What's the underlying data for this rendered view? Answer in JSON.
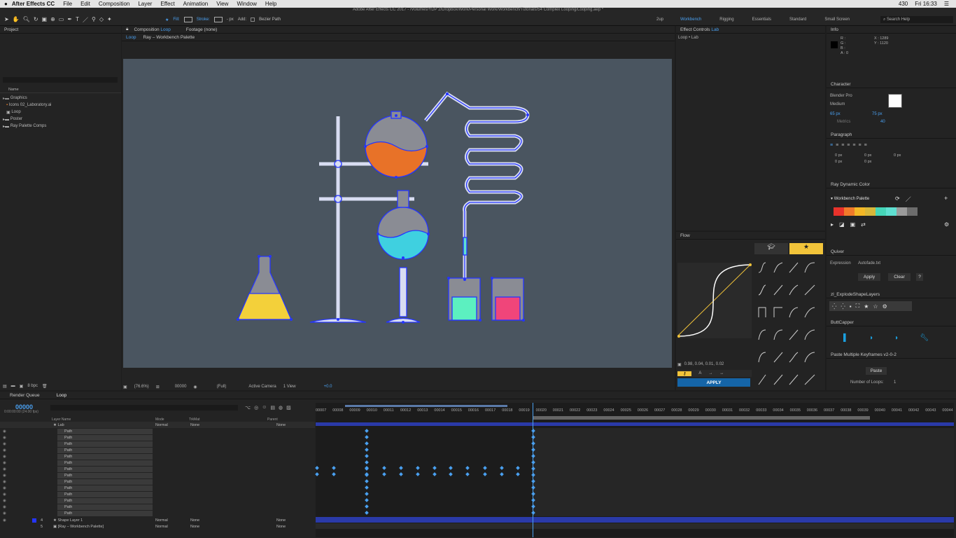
{
  "menubar": {
    "app": "After Effects CC",
    "items": [
      "File",
      "Edit",
      "Composition",
      "Layer",
      "Effect",
      "Animation",
      "View",
      "Window",
      "Help"
    ],
    "status": {
      "battery": "430",
      "clock": "Fri 16:33"
    }
  },
  "window_title": "Adobe After Effects CC 2017 - /Volumes/YDP 2/Dropbox/Work/Personal Work/Workbench/Tutorials/54 Complex Looping/Looping.aep *",
  "toolbar": {
    "fill": "Fill:",
    "stroke": "Stroke:",
    "px": "- px",
    "add": "Add:",
    "bezier": "Bezier Path",
    "twoup": "2up",
    "workspaces": [
      "Workbench",
      "Rigging",
      "Essentials",
      "Standard",
      "Small Screen"
    ],
    "search": "Search Help"
  },
  "project": {
    "title": "Project",
    "col_name": "Name",
    "items": [
      "Graphics",
      "Icons 02_Laboratory.ai",
      "Loop",
      "Poster",
      "Ray Palette Comps"
    ],
    "bpc": "8 bpc"
  },
  "comp": {
    "tab": "Composition",
    "tab_name": "Loop",
    "footage": "Footage (none)",
    "breadcrumb1": "Loop",
    "breadcrumb2": "Ray – Workbench Palette",
    "zoom": "(76.6%)",
    "time": "00000",
    "res": "(Full)",
    "camera": "Active Camera",
    "views": "1 View",
    "offset": "+0.0"
  },
  "effect_controls": {
    "title": "Effect Controls",
    "layer": "Lab",
    "path": "Loop • Lab"
  },
  "info": {
    "title": "Info",
    "r": "R :",
    "g": "G :",
    "b": "B :",
    "a": "A : 0",
    "x": "X : 1289",
    "y": "Y : 1120"
  },
  "character": {
    "title": "Character",
    "font": "Blender Pro",
    "style": "Medium",
    "size": "65 px",
    "leading": "75 px",
    "metrics": "Metrics",
    "tracking": "40"
  },
  "paragraph": {
    "title": "Paragraph",
    "v1": "0 px",
    "v2": "0 px",
    "v3": "0 px",
    "v4": "0 px",
    "v5": "0 px"
  },
  "ray": {
    "title": "Ray Dynamic Color",
    "palette": "Workbench Palette",
    "colors": [
      "#e8322b",
      "#f07a2a",
      "#f3b726",
      "#d7b73a",
      "#45d6b8",
      "#5fdfd0",
      "#9a9a9a",
      "#6c6c6c"
    ]
  },
  "quiver": {
    "title": "Quiver",
    "expr_label": "Expression",
    "expr_value": "Autofade.txt",
    "apply": "Apply",
    "clear": "Clear",
    "q": "?"
  },
  "explode": {
    "title": "zl_ExplodeShapeLayers"
  },
  "butt": {
    "title": "ButtCapper"
  },
  "paste": {
    "title": "Paste Multiple Keyframes v2-0-2",
    "button": "Paste",
    "loops_label": "Number of Loops:",
    "loops_value": "1"
  },
  "flow": {
    "title": "Flow",
    "curve": "0.98, 0.04, 0.01, 0.02",
    "apply": "APPLY"
  },
  "timeline": {
    "render_tab": "Render Queue",
    "tab": "Loop",
    "time": "00000",
    "fps": "0:00:00:00 (24.00 fps)",
    "cols": {
      "layer": "Layer Name",
      "mode": "Mode",
      "trk": "TrkMat",
      "parent": "Parent"
    },
    "lab": {
      "name": "Lab",
      "mode": "Normal",
      "trk": "None",
      "parent": "None"
    },
    "path_label": "Path",
    "layers": [
      {
        "num": "4",
        "name": "Shape Layer 1",
        "mode": "Normal",
        "trk": "None",
        "parent": "None"
      },
      {
        "num": "5",
        "name": "[Ray – Workbench Palette]",
        "mode": "Normal",
        "trk": "None",
        "parent": "None"
      }
    ],
    "ticks": [
      "00007",
      "00008",
      "00009",
      "00010",
      "00011",
      "00012",
      "00013",
      "00014",
      "00015",
      "00016",
      "00017",
      "00018",
      "00019",
      "00020",
      "00021",
      "00022",
      "00023",
      "00024",
      "00025",
      "00026",
      "00027",
      "00028",
      "00029",
      "00030",
      "00031",
      "00032",
      "00033",
      "00034",
      "00035",
      "00036",
      "00037",
      "00038",
      "00039",
      "00040",
      "00041",
      "00042",
      "00043",
      "00044"
    ]
  }
}
